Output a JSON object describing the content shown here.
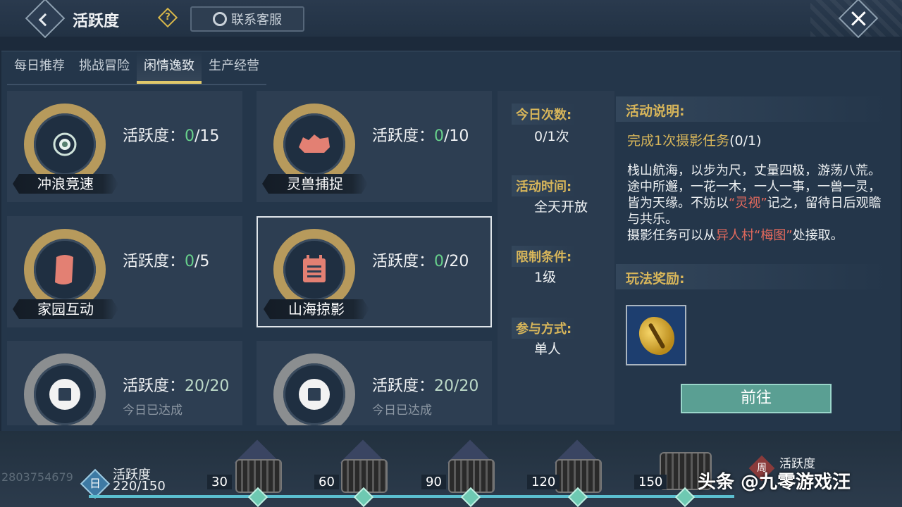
{
  "header": {
    "title": "活跃度",
    "help_icon": "question-diamond-icon",
    "service_label": "联系客服",
    "close_icon": "close-x-icon"
  },
  "tabs": [
    {
      "label": "每日推荐",
      "active": false
    },
    {
      "label": "挑战冒险",
      "active": false
    },
    {
      "label": "闲情逸致",
      "active": true
    },
    {
      "label": "生产经营",
      "active": false
    }
  ],
  "activities": [
    {
      "name": "冲浪竞速",
      "score_label": "活跃度：",
      "current": "0",
      "max": "/15",
      "done": false,
      "icon": "surf-orb-icon"
    },
    {
      "name": "灵兽捕捉",
      "score_label": "活跃度：",
      "current": "0",
      "max": "/10",
      "done": false,
      "icon": "beast-icon"
    },
    {
      "name": "家园互动",
      "score_label": "活跃度：",
      "current": "0",
      "max": "/5",
      "done": false,
      "icon": "scroll-icon"
    },
    {
      "name": "山海掠影",
      "score_label": "活跃度：",
      "current": "0",
      "max": "/20",
      "done": false,
      "icon": "calendar-icon",
      "selected": true
    },
    {
      "name": "",
      "score_label": "活跃度：",
      "current": "20",
      "max": "/20",
      "done": true,
      "status": "今日已达成",
      "icon": "coin-icon"
    },
    {
      "name": "",
      "score_label": "活跃度：",
      "current": "20",
      "max": "/20",
      "done": true,
      "status": "今日已达成",
      "icon": "coin-icon"
    }
  ],
  "info": {
    "count_label": "今日次数:",
    "count_value": "0/1次",
    "time_label": "活动时间:",
    "time_value": "全天开放",
    "limit_label": "限制条件:",
    "limit_value": "1级",
    "mode_label": "参与方式:",
    "mode_value": "单人"
  },
  "description": {
    "heading": "活动说明:",
    "task": "完成1次摄影任务",
    "task_progress": "(0/1)",
    "story_part1": "栈山航海，以步为尺，丈量四极，游荡八荒。途中所邂，一花一木，一人一事，一兽一灵，皆为天缘。不妨以",
    "story_hl1": "“灵视”",
    "story_part2": "记之，留待日后观瞻与共乐。",
    "story_part3": "摄影任务可以从",
    "story_hl2": "异人村“梅图”",
    "story_part4": "处接取。",
    "reward_heading": "玩法奖励:",
    "reward_icon": "golden-shell-icon",
    "go_button": "前往"
  },
  "progress_bar": {
    "uid_text": "2803754679",
    "day_badge": "日",
    "label": "活跃度",
    "value": "220/150",
    "milestones": [
      "30",
      "60",
      "90",
      "120",
      "150"
    ],
    "week_badge": "周",
    "week_label": "活跃度"
  },
  "watermark": "头条 @九零游戏汪"
}
